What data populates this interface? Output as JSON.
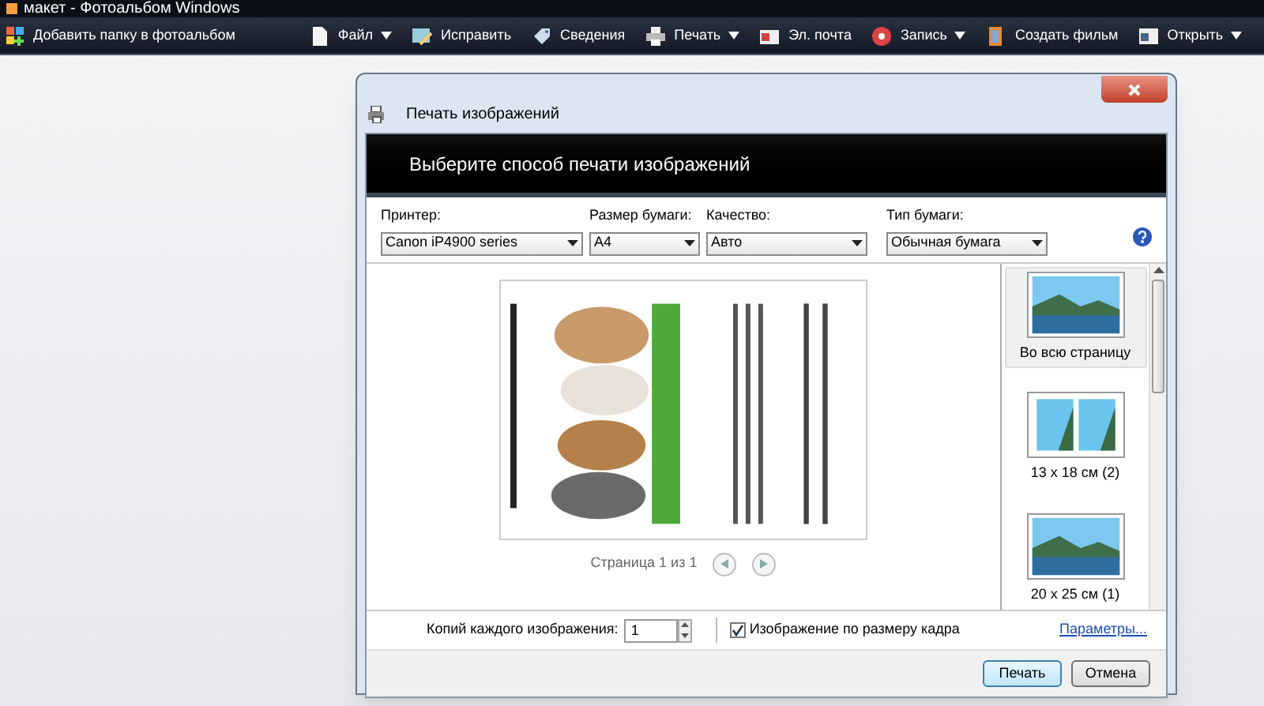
{
  "window": {
    "title": "макет - Фотоальбом Windows"
  },
  "toolbar": {
    "left": {
      "label": "Добавить папку в фотоальбом"
    },
    "items": [
      {
        "label": "Файл",
        "has_menu": true
      },
      {
        "label": "Исправить",
        "has_menu": false
      },
      {
        "label": "Сведения",
        "has_menu": false
      },
      {
        "label": "Печать",
        "has_menu": true
      },
      {
        "label": "Эл. почта",
        "has_menu": false
      },
      {
        "label": "Запись",
        "has_menu": true
      },
      {
        "label": "Создать фильм",
        "has_menu": false
      },
      {
        "label": "Открыть",
        "has_menu": true
      }
    ]
  },
  "dialog": {
    "title": "Печать изображений",
    "heading": "Выберите способ печати изображений",
    "selects": [
      {
        "label": "Принтер:",
        "value": "Canon iP4900 series"
      },
      {
        "label": "Размер бумаги:",
        "value": "A4"
      },
      {
        "label": "Качество:",
        "value": "Авто"
      },
      {
        "label": "Тип бумаги:",
        "value": "Обычная бумага"
      }
    ],
    "pager": "Страница 1 из 1",
    "layouts": [
      {
        "label": "Во всю страницу",
        "kind": "single",
        "selected": true
      },
      {
        "label": "13 x 18 см (2)",
        "kind": "double",
        "selected": false
      },
      {
        "label": "20 x 25 см (1)",
        "kind": "single",
        "selected": false
      }
    ],
    "copies": {
      "label": "Копий каждого изображения:",
      "value": "1"
    },
    "fit": {
      "label": "Изображение по размеру кадра",
      "checked": true
    },
    "options_link": "Параметры...",
    "buttons": [
      {
        "label": "Печать",
        "default": true
      },
      {
        "label": "Отмена",
        "default": false
      }
    ]
  }
}
